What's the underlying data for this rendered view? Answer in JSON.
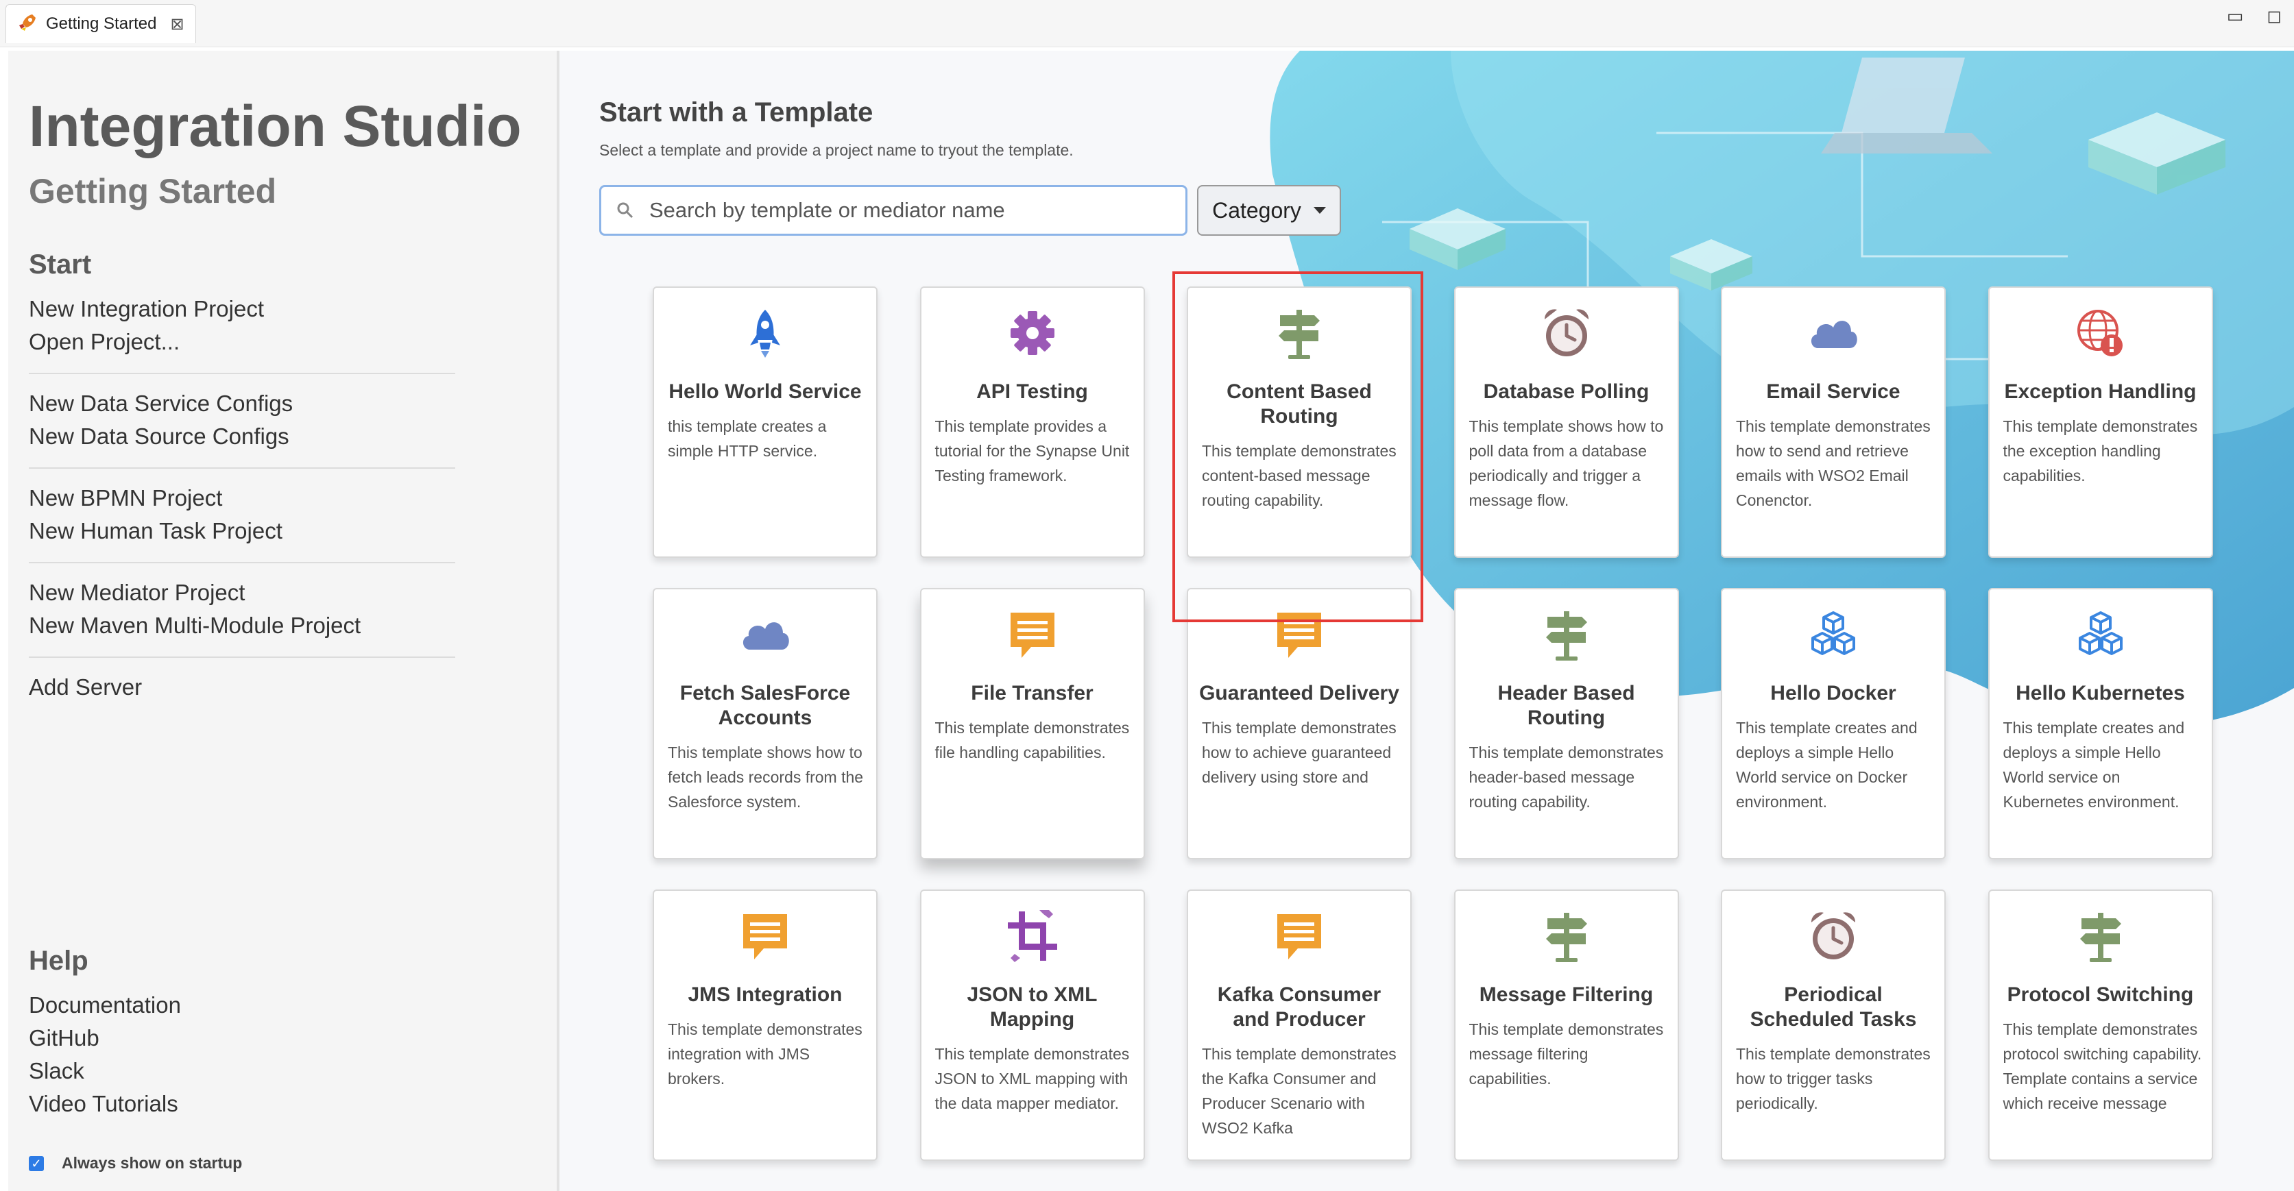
{
  "tab": {
    "title": "Getting Started",
    "close_glyph": "⊠",
    "icon": "rocket-icon"
  },
  "window_controls": {
    "minimize_glyph": "▭",
    "maximize_glyph": "◻"
  },
  "sidebar": {
    "app_title": "Integration Studio",
    "app_subtitle": "Getting Started",
    "start_heading": "Start",
    "start_groups": [
      [
        "New Integration Project",
        "Open Project..."
      ],
      [
        "New Data Service Configs",
        "New Data Source Configs"
      ],
      [
        "New BPMN Project",
        "New Human Task Project"
      ],
      [
        "New Mediator Project",
        "New Maven Multi-Module Project"
      ],
      [
        "Add Server"
      ]
    ],
    "help_heading": "Help",
    "help_links": [
      "Documentation",
      "GitHub",
      "Slack",
      "Video Tutorials"
    ],
    "always_show_label": "Always show on startup",
    "always_show_checked": true
  },
  "main": {
    "heading": "Start with a Template",
    "subheading": "Select a template and provide a project name to tryout the template.",
    "search_placeholder": "Search by template or mediator name",
    "category_label": "Category",
    "highlighted_card_index": 2,
    "accent_colors": {
      "selection_border": "#e53935",
      "search_border": "#8cb4e8"
    },
    "cards": [
      {
        "title": "Hello World Service",
        "icon": "rocket-icon",
        "color": "#2d6fd6",
        "description": "this template creates a simple HTTP service."
      },
      {
        "title": "API Testing",
        "icon": "gear-icon",
        "color": "#9b59b6",
        "description": "This template provides a tutorial for the Synapse Unit Testing framework."
      },
      {
        "title": "Content Based Routing",
        "icon": "signpost-icon",
        "color": "#7f9a6a",
        "description": "This template demonstrates content-based message routing capability."
      },
      {
        "title": "Database Polling",
        "icon": "alarm-clock-icon",
        "color": "#8e6e6e",
        "description": "This template shows how to poll data from a database periodically and trigger a message flow."
      },
      {
        "title": "Email Service",
        "icon": "cloud-icon",
        "color": "#6f86c4",
        "description": "This template demonstrates how to send and retrieve emails with WSO2 Email Conenctor."
      },
      {
        "title": "Exception Handling",
        "icon": "globe-alert-icon",
        "color": "#d9534f",
        "description": "This template demonstrates the exception handling capabilities."
      },
      {
        "title": "Fetch SalesForce Accounts",
        "icon": "cloud-icon",
        "color": "#6f86c4",
        "description": "This template shows how to fetch leads records from the Salesforce system."
      },
      {
        "title": "File Transfer",
        "icon": "message-icon",
        "color": "#f0a030",
        "description": "This template demonstrates file handling capabilities."
      },
      {
        "title": "Guaranteed Delivery",
        "icon": "message-icon",
        "color": "#f0a030",
        "description": "This template demonstrates how to achieve guaranteed delivery using store and"
      },
      {
        "title": "Header Based Routing",
        "icon": "signpost-icon",
        "color": "#7f9a6a",
        "description": "This template demonstrates header-based message routing capability."
      },
      {
        "title": "Hello Docker",
        "icon": "cubes-icon",
        "color": "#3a86e0",
        "description": "This template creates and deploys a simple Hello World service on Docker environment."
      },
      {
        "title": "Hello Kubernetes",
        "icon": "cubes-icon",
        "color": "#3a86e0",
        "description": "This template creates and deploys a simple Hello World service on Kubernetes environment."
      },
      {
        "title": "JMS Integration",
        "icon": "message-icon",
        "color": "#f0a030",
        "description": "This template demonstrates integration with JMS brokers."
      },
      {
        "title": "JSON to XML Mapping",
        "icon": "crop-icon",
        "color": "#8e44ad",
        "description": "This template demonstrates JSON to XML mapping with the data mapper mediator."
      },
      {
        "title": "Kafka Consumer and Producer",
        "icon": "message-icon",
        "color": "#f0a030",
        "description": "This template demonstrates the Kafka Consumer and Producer Scenario with WSO2 Kafka"
      },
      {
        "title": "Message Filtering",
        "icon": "signpost-icon",
        "color": "#7f9a6a",
        "description": "This template demonstrates message filtering capabilities."
      },
      {
        "title": "Periodical Scheduled Tasks",
        "icon": "alarm-clock-icon",
        "color": "#8e6e6e",
        "description": "This template demonstrates how to trigger tasks periodically."
      },
      {
        "title": "Protocol Switching",
        "icon": "signpost-icon",
        "color": "#7f9a6a",
        "description": "This template demonstrates protocol switching capability. Template contains a service which receive message"
      }
    ]
  }
}
